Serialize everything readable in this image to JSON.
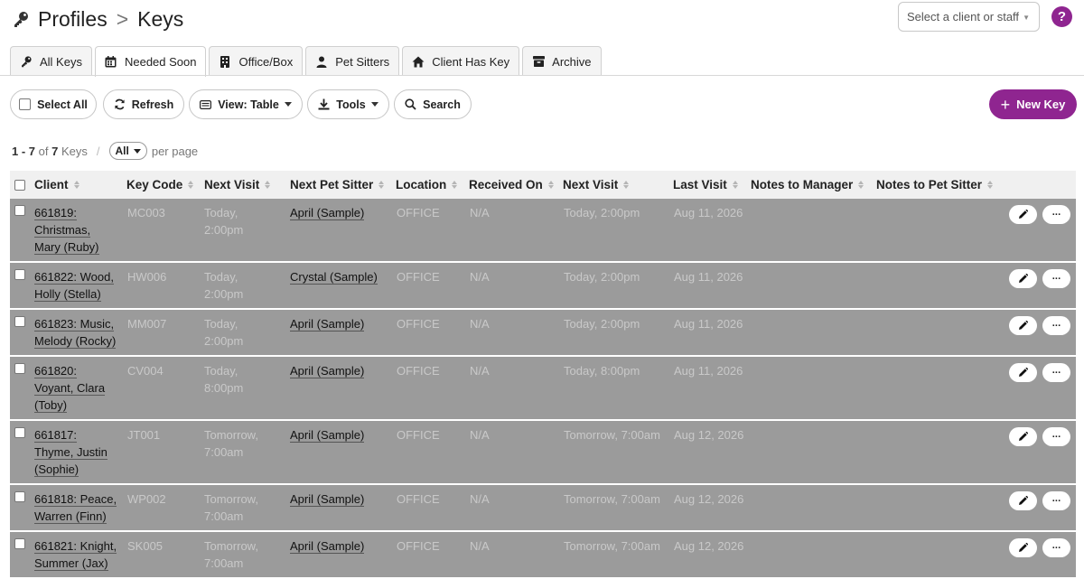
{
  "header": {
    "title": "Profiles",
    "separator": ">",
    "subtitle": "Keys",
    "client_select_placeholder": "Select a client or staff",
    "help_label": "?"
  },
  "tabs": [
    {
      "label": "All Keys",
      "icon": "key-icon"
    },
    {
      "label": "Needed Soon",
      "icon": "calendar-icon",
      "active": true
    },
    {
      "label": "Office/Box",
      "icon": "building-icon"
    },
    {
      "label": "Pet Sitters",
      "icon": "user-icon"
    },
    {
      "label": "Client Has Key",
      "icon": "home-icon"
    },
    {
      "label": "Archive",
      "icon": "archive-icon"
    }
  ],
  "toolbar": {
    "select_all": "Select All",
    "refresh": "Refresh",
    "view": "View: Table",
    "tools": "Tools",
    "search": "Search",
    "new_key": "New Key"
  },
  "pager": {
    "range": "1 - 7",
    "of": "of",
    "total": "7",
    "unit": "Keys",
    "per_page_value": "All",
    "per_page_label": "per page"
  },
  "columns": [
    "Client",
    "Key Code",
    "Next Visit",
    "Next Pet Sitter",
    "Location",
    "Received On",
    "Next Visit",
    "Last Visit",
    "Notes to Manager",
    "Notes to Pet Sitter"
  ],
  "rows": [
    {
      "client": [
        "661819:",
        "Christmas,",
        "Mary (Ruby)"
      ],
      "key_code": "MC003",
      "next_visit": [
        "Today,",
        "2:00pm"
      ],
      "sitter": "April (Sample)",
      "location": "OFFICE",
      "received": "N/A",
      "next_visit2": "Today, 2:00pm",
      "last_visit": "Aug 11, 2026"
    },
    {
      "client": [
        "661822: Wood,",
        "Holly (Stella)"
      ],
      "key_code": "HW006",
      "next_visit": [
        "Today,",
        "2:00pm"
      ],
      "sitter": "Crystal (Sample)",
      "location": "OFFICE",
      "received": "N/A",
      "next_visit2": "Today, 2:00pm",
      "last_visit": "Aug 11, 2026"
    },
    {
      "client": [
        "661823: Music,",
        "Melody (Rocky)"
      ],
      "key_code": "MM007",
      "next_visit": [
        "Today,",
        "2:00pm"
      ],
      "sitter": "April (Sample)",
      "location": "OFFICE",
      "received": "N/A",
      "next_visit2": "Today, 2:00pm",
      "last_visit": "Aug 11, 2026"
    },
    {
      "client": [
        "661820:",
        "Voyant, Clara",
        "(Toby)"
      ],
      "key_code": "CV004",
      "next_visit": [
        "Today,",
        "8:00pm"
      ],
      "sitter": "April (Sample)",
      "location": "OFFICE",
      "received": "N/A",
      "next_visit2": "Today, 8:00pm",
      "last_visit": "Aug 11, 2026"
    },
    {
      "client": [
        "661817:",
        "Thyme, Justin",
        "(Sophie)"
      ],
      "key_code": "JT001",
      "next_visit": [
        "Tomorrow,",
        "7:00am"
      ],
      "sitter": "April (Sample)",
      "location": "OFFICE",
      "received": "N/A",
      "next_visit2": "Tomorrow, 7:00am",
      "last_visit": "Aug 12, 2026"
    },
    {
      "client": [
        "661818: Peace,",
        "Warren (Finn)"
      ],
      "key_code": "WP002",
      "next_visit": [
        "Tomorrow,",
        "7:00am"
      ],
      "sitter": "April (Sample)",
      "location": "OFFICE",
      "received": "N/A",
      "next_visit2": "Tomorrow, 7:00am",
      "last_visit": "Aug 12, 2026"
    },
    {
      "client": [
        "661821: Knight,",
        "Summer (Jax)"
      ],
      "key_code": "SK005",
      "next_visit": [
        "Tomorrow,",
        "7:00am"
      ],
      "sitter": "April (Sample)",
      "location": "OFFICE",
      "received": "N/A",
      "next_visit2": "Tomorrow, 7:00am",
      "last_visit": "Aug 12, 2026"
    }
  ],
  "row_actions": {
    "edit_icon": "pencil-icon",
    "more_label": "···"
  },
  "colors": {
    "brand": "#8f2590",
    "row_bg": "#9b9b9b",
    "header_bg": "#f0f0f0"
  }
}
